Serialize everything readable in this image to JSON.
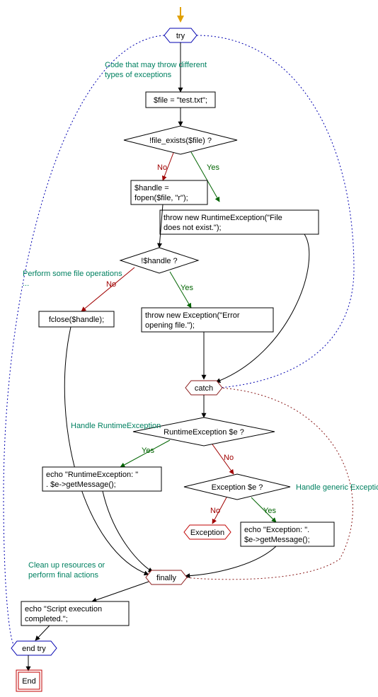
{
  "chart_data": {
    "type": "flowchart",
    "title": "",
    "nodes": [
      {
        "id": "start_arrow",
        "kind": "start",
        "label": ""
      },
      {
        "id": "try",
        "kind": "try",
        "label": "try"
      },
      {
        "id": "file_assign",
        "kind": "process",
        "label": "$file = \"test.txt\";"
      },
      {
        "id": "file_exists",
        "kind": "decision",
        "label": "!file_exists($file) ?"
      },
      {
        "id": "fopen",
        "kind": "process",
        "label": "$handle =\nfopen($file, \"r\");"
      },
      {
        "id": "throw_rt",
        "kind": "process",
        "label": "throw new RuntimeException(\"File\ndoes not exist.\");"
      },
      {
        "id": "handle_q",
        "kind": "decision",
        "label": "!$handle ?"
      },
      {
        "id": "fclose",
        "kind": "process",
        "label": "fclose($handle);"
      },
      {
        "id": "throw_ex",
        "kind": "process",
        "label": "throw new Exception(\"Error\nopening file.\");"
      },
      {
        "id": "catch",
        "kind": "catch",
        "label": "catch"
      },
      {
        "id": "rt_q",
        "kind": "decision",
        "label": "RuntimeException $e ?"
      },
      {
        "id": "echo_rt",
        "kind": "process",
        "label": "echo \"RuntimeException: \"\n. $e->getMessage();"
      },
      {
        "id": "ex_q",
        "kind": "decision",
        "label": "Exception $e ?"
      },
      {
        "id": "exception",
        "kind": "terminal",
        "label": "Exception"
      },
      {
        "id": "echo_ex",
        "kind": "process",
        "label": "echo \"Exception: \"\n. $e->getMessage();"
      },
      {
        "id": "finally",
        "kind": "finally",
        "label": "finally"
      },
      {
        "id": "echo_done",
        "kind": "process",
        "label": "echo \"Script execution\ncompleted.\";"
      },
      {
        "id": "end_try",
        "kind": "endtry",
        "label": "end try"
      },
      {
        "id": "end",
        "kind": "end",
        "label": "End"
      }
    ],
    "edges": [
      {
        "from": "start_arrow",
        "to": "try"
      },
      {
        "from": "try",
        "to": "file_assign"
      },
      {
        "from": "file_assign",
        "to": "file_exists"
      },
      {
        "from": "file_exists",
        "to": "fopen",
        "label": "No"
      },
      {
        "from": "file_exists",
        "to": "throw_rt",
        "label": "Yes"
      },
      {
        "from": "fopen",
        "to": "handle_q"
      },
      {
        "from": "throw_rt",
        "to": "catch"
      },
      {
        "from": "handle_q",
        "to": "fclose",
        "label": "No"
      },
      {
        "from": "handle_q",
        "to": "throw_ex",
        "label": "Yes"
      },
      {
        "from": "fclose",
        "to": "finally"
      },
      {
        "from": "throw_ex",
        "to": "catch"
      },
      {
        "from": "catch",
        "to": "rt_q"
      },
      {
        "from": "rt_q",
        "to": "echo_rt",
        "label": "Yes"
      },
      {
        "from": "rt_q",
        "to": "ex_q",
        "label": "No"
      },
      {
        "from": "echo_rt",
        "to": "finally"
      },
      {
        "from": "ex_q",
        "to": "exception",
        "label": "No"
      },
      {
        "from": "ex_q",
        "to": "echo_ex",
        "label": "Yes"
      },
      {
        "from": "echo_ex",
        "to": "finally"
      },
      {
        "from": "try",
        "to": "catch",
        "style": "dotted"
      },
      {
        "from": "catch",
        "to": "finally",
        "style": "dotted"
      },
      {
        "from": "finally",
        "to": "echo_done"
      },
      {
        "from": "echo_done",
        "to": "end_try"
      },
      {
        "from": "try",
        "to": "end_try",
        "style": "dotted"
      },
      {
        "from": "end_try",
        "to": "end"
      }
    ],
    "comments": [
      {
        "for": "file_assign",
        "text": "Code that may throw different\ntypes of exceptions"
      },
      {
        "for": "fclose",
        "text": "Perform some file operations\n..."
      },
      {
        "for": "echo_rt",
        "text": "Handle RuntimeException"
      },
      {
        "for": "echo_ex",
        "text": "Handle generic Exception"
      },
      {
        "for": "echo_done",
        "text": "Clean up resources or\nperform final actions"
      }
    ]
  },
  "labels": {
    "try": "try",
    "catch": "catch",
    "finally": "finally",
    "end_try": "end try",
    "end": "End",
    "exception": "Exception",
    "yes": "Yes",
    "no": "No",
    "file_assign": "$file = \"test.txt\";",
    "file_exists": "!file_exists($file) ?",
    "fopen_l1": "$handle =",
    "fopen_l2": "fopen($file, \"r\");",
    "throw_rt_l1": "throw new RuntimeException(\"File",
    "throw_rt_l2": "does not exist.\");",
    "handle_q": "!$handle ?",
    "fclose": "fclose($handle);",
    "throw_ex_l1": "throw new Exception(\"Error",
    "throw_ex_l2": "opening file.\");",
    "rt_q": "RuntimeException $e ?",
    "echo_rt_l1": "echo \"RuntimeException: \"",
    "echo_rt_l2": ". $e->getMessage();",
    "ex_q": "Exception $e ?",
    "echo_ex_l1": "echo \"Exception: \".",
    "echo_ex_l2": "$e->getMessage();",
    "echo_done_l1": "echo \"Script execution",
    "echo_done_l2": "completed.\";",
    "c1_l1": "Code that may throw different",
    "c1_l2": "types of exceptions",
    "c2_l1": "Perform some file operations",
    "c2_l2": "...",
    "c3": "Handle RuntimeException",
    "c4": "Handle generic Exception",
    "c5_l1": "Clean up resources or",
    "c5_l2": "perform final actions"
  }
}
